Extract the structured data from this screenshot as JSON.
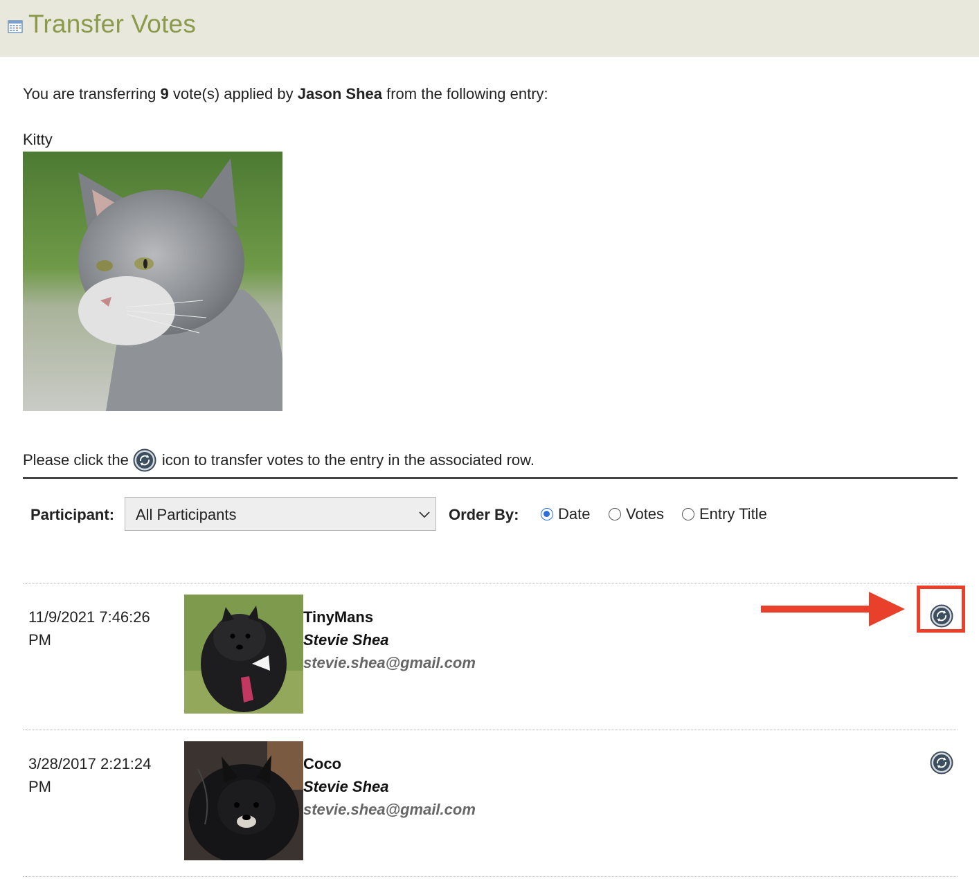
{
  "header": {
    "title": "Transfer Votes",
    "icon": "calendar-icon"
  },
  "intro": {
    "prefix": "You are transferring",
    "vote_count": "9",
    "middle": "vote(s) applied by",
    "voter": "Jason Shea",
    "suffix": "from the following entry:"
  },
  "source_entry": {
    "title": "Kitty",
    "image": "gray-cat-photo"
  },
  "instruction": {
    "before": "Please click the",
    "icon": "transfer-icon",
    "after": "icon to transfer votes to the entry in the associated row."
  },
  "filters": {
    "participant_label": "Participant:",
    "participant_value": "All Participants",
    "order_label": "Order By:",
    "order_options": [
      {
        "label": "Date",
        "checked": true
      },
      {
        "label": "Votes",
        "checked": false
      },
      {
        "label": "Entry Title",
        "checked": false
      }
    ]
  },
  "rows": [
    {
      "date": "11/9/2021 7:46:26 PM",
      "title": "TinyMans",
      "participant": "Stevie Shea",
      "email": "stevie.shea@gmail.com",
      "image": "black-pomeranian-with-tie-photo",
      "highlighted": true
    },
    {
      "date": "3/28/2017 2:21:24 PM",
      "title": "Coco",
      "participant": "Stevie Shea",
      "email": "stevie.shea@gmail.com",
      "image": "black-pomeranian-photo",
      "highlighted": false
    }
  ],
  "colors": {
    "header_bg": "#e8e9dc",
    "title_green": "#8a9a4a",
    "callout_red": "#e8402a",
    "radio_blue": "#2a6fdb"
  }
}
